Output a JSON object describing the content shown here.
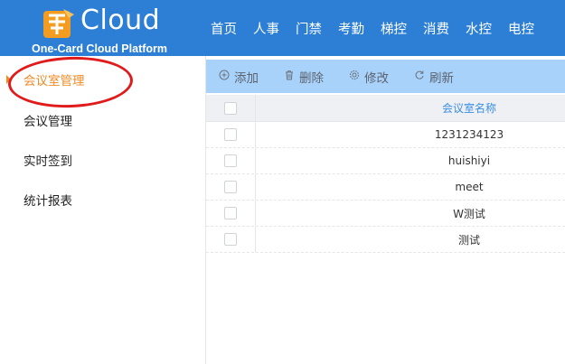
{
  "header": {
    "logo_mark": "卡通",
    "logo_text": "Cloud",
    "logo_subtitle": "One-Card Cloud Platform",
    "nav": [
      "首页",
      "人事",
      "门禁",
      "考勤",
      "梯控",
      "消费",
      "水控",
      "电控"
    ]
  },
  "sidebar": {
    "items": [
      "会议室管理",
      "会议管理",
      "实时签到",
      "统计报表"
    ],
    "active_index": 0
  },
  "toolbar": {
    "buttons": [
      {
        "icon": "plus-circle-icon",
        "label": "添加"
      },
      {
        "icon": "trash-icon",
        "label": "删除"
      },
      {
        "icon": "gear-icon",
        "label": "修改"
      },
      {
        "icon": "refresh-icon",
        "label": "刷新"
      }
    ]
  },
  "table": {
    "column_header": "会议室名称",
    "rows": [
      "1231234123",
      "huishiyi",
      "meet",
      "W测试",
      "测试"
    ]
  },
  "colors": {
    "header_bg": "#2d7fd6",
    "toolbar_bg": "#a9d2fa",
    "active_item": "#f08a24",
    "annotation_ring": "#e11b1b",
    "header_link": "#3a8ee6"
  }
}
